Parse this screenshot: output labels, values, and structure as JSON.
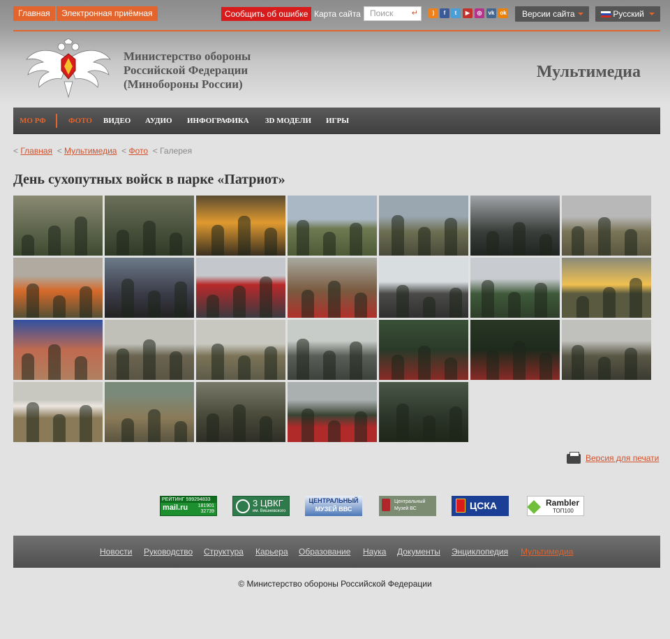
{
  "topbar": {
    "home": "Главная",
    "reception": "Электронная приёмная",
    "report_error": "Сообщить об ошибке",
    "sitemap": "Карта сайта",
    "search_placeholder": "Поиск",
    "versions": "Версии сайта",
    "language": "Русский",
    "social_icons": [
      "rss-icon",
      "facebook-icon",
      "twitter-icon",
      "youtube-icon",
      "instagram-icon",
      "vk-icon",
      "odnoklassniki-icon"
    ]
  },
  "header": {
    "ministry_line1": "Министерство обороны",
    "ministry_line2": "Российской Федерации",
    "ministry_line3": "(Минобороны России)",
    "section_title": "Мультимедиа"
  },
  "nav": {
    "items": [
      "МО РФ",
      "ФОТО",
      "ВИДЕО",
      "АУДИО",
      "ИНФОГРАФИКА",
      "3D МОДЕЛИ",
      "ИГРЫ"
    ],
    "active": "ФОТО"
  },
  "breadcrumbs": {
    "items": [
      "Главная",
      "Мультимедиа",
      "Фото"
    ],
    "current": "Галерея"
  },
  "gallery": {
    "title": "День сухопутных войск в парке «Патриот»",
    "photo_count": 26
  },
  "print_link": "Версия для печати",
  "banners": {
    "mail_top": "РЕЙТИНГ 599294833",
    "mail_brand": "mail.ru",
    "mail_n1": "181901",
    "mail_n2": "32739",
    "cvkg_name": "3 ЦВКГ",
    "cvkg_sub": "им. Вишневского",
    "vvs_line1": "ЦЕНТРАЛЬНЫЙ",
    "vvs_line2": "МУЗЕЙ ВВС",
    "museum_line1": "Центральный",
    "museum_line2": "Музей ВС",
    "cska": "ЦСКА",
    "rambler": "Rambler",
    "rambler_top": "ТОП100"
  },
  "footer": {
    "links": [
      "Новости",
      "Руководство",
      "Структура",
      "Карьера",
      "Образование",
      "Наука",
      "Документы",
      "Энциклопедия",
      "Мультимедиа"
    ],
    "active": "Мультимедиа",
    "copyright": "© Министерство обороны Российской Федерации"
  },
  "colors": {
    "accent": "#e3642c",
    "error_button": "#d81b1b",
    "nav_bg": "#4a4a4a",
    "page_bg": "#e2e2e2"
  }
}
